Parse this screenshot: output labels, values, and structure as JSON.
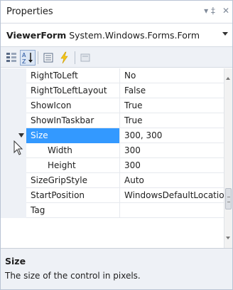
{
  "window": {
    "title": "Properties",
    "pin_glyph": "▾ ‡",
    "close_glyph": "✕"
  },
  "object_selector": {
    "name": "ViewerForm",
    "type": "System.Windows.Forms.Form"
  },
  "toolbar": {
    "buttons": [
      "categorized-icon",
      "alphabetical-icon",
      "properties-icon",
      "events-icon",
      "property-pages-icon"
    ],
    "active": "alphabetical-icon"
  },
  "grid": {
    "rows": [
      {
        "name": "RightToLeft",
        "value": "No"
      },
      {
        "name": "RightToLeftLayout",
        "value": "False"
      },
      {
        "name": "ShowIcon",
        "value": "True"
      },
      {
        "name": "ShowInTaskbar",
        "value": "True"
      },
      {
        "name": "Size",
        "value": "300, 300"
      },
      {
        "name": "Width",
        "value": "300"
      },
      {
        "name": "Height",
        "value": "300"
      },
      {
        "name": "SizeGripStyle",
        "value": "Auto"
      },
      {
        "name": "StartPosition",
        "value": "WindowsDefaultLocation"
      },
      {
        "name": "Tag",
        "value": ""
      }
    ],
    "selected": "Size"
  },
  "description": {
    "title": "Size",
    "text": "The size of the control in pixels."
  },
  "colors": {
    "selection": "#3399ff",
    "margin": "#eef1f6",
    "accent": "#f5c518"
  }
}
